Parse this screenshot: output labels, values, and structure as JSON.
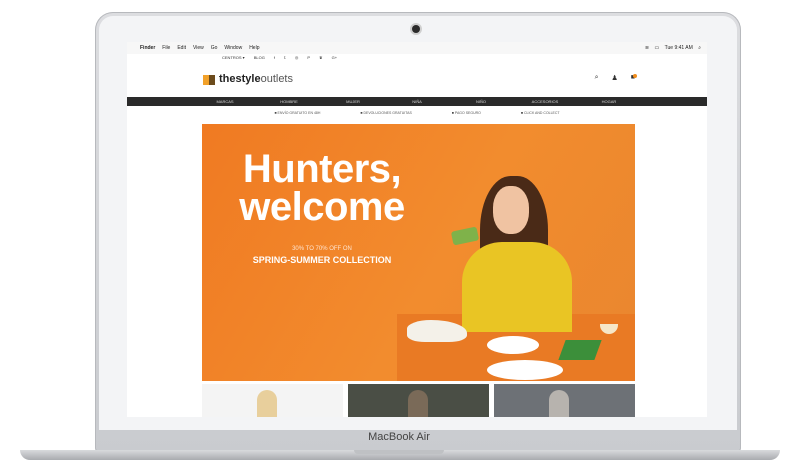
{
  "device": {
    "brand_label": "MacBook Air"
  },
  "menubar": {
    "items": [
      "Finder",
      "File",
      "Edit",
      "View",
      "Go",
      "Window",
      "Help"
    ],
    "clock": "Tue 9:41 AM"
  },
  "toplinks": {
    "centros": "CENTROS ▾",
    "blog": "BLOG",
    "social": [
      "f",
      "𝕥",
      "◎",
      "P",
      "♛",
      "G+"
    ]
  },
  "header": {
    "logo_bold": "thestyle",
    "logo_light": "outlets"
  },
  "nav": {
    "items": [
      "MARCAS",
      "HOMBRE",
      "MUJER",
      "NIÑA",
      "NIÑO",
      "ACCESORIOS",
      "HOGAR"
    ]
  },
  "info_strip": {
    "items": [
      "ENVÍO GRATUITO EN 48H",
      "DEVOLUCIONES GRATUITAS",
      "PAGO SEGURO",
      "CLICK AND COLLECT"
    ]
  },
  "hero": {
    "title_line1": "Hunters,",
    "title_line2": "welcome",
    "subtitle": "30% TO 70% OFF ON",
    "collection": "SPRING-SUMMER COLLECTION"
  },
  "colors": {
    "hero_orange": "#f07a22",
    "nav_dark": "#2a2a2a",
    "accent": "#f08d1c"
  }
}
